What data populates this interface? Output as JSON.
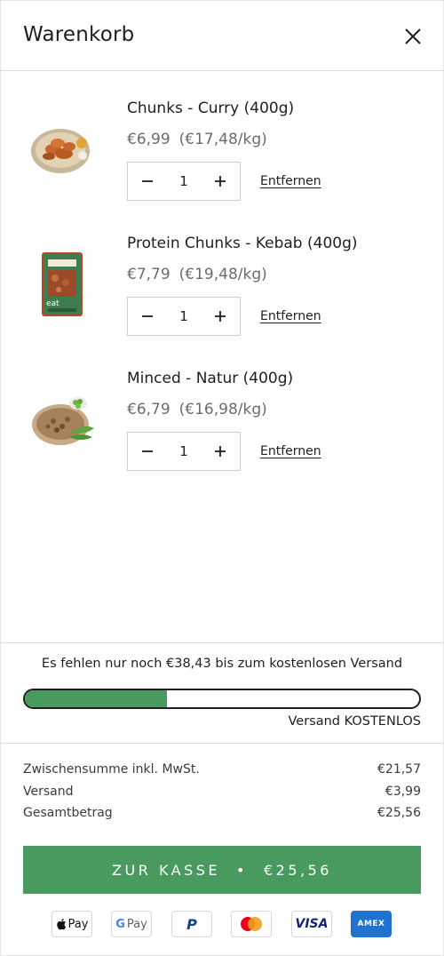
{
  "header": {
    "title": "Warenkorb"
  },
  "items": [
    {
      "name": "Chunks - Curry (400g)",
      "price": "€6,99",
      "unit_price": "(€17,48/kg)",
      "qty": "1",
      "remove": "Entfernen",
      "image": "curry-chunks-bowl-image"
    },
    {
      "name": "Protein Chunks - Kebab (400g)",
      "price": "€7,79",
      "unit_price": "(€19,48/kg)",
      "qty": "1",
      "remove": "Entfernen",
      "image": "kebab-chunks-package-image"
    },
    {
      "name": "Minced - Natur (400g)",
      "price": "€6,79",
      "unit_price": "(€16,98/kg)",
      "qty": "1",
      "remove": "Entfernen",
      "image": "minced-natur-plate-image"
    }
  ],
  "shipping": {
    "message": "Es fehlen nur noch €38,43 bis zum kostenlosen Versand",
    "progress_fraction": 0.36,
    "status": "Versand KOSTENLOS"
  },
  "totals": {
    "subtotal_label": "Zwischensumme inkl. MwSt.",
    "subtotal_value": "€21,57",
    "shipping_label": "Versand",
    "shipping_value": "€3,99",
    "total_label": "Gesamtbetrag",
    "total_value": "€25,56"
  },
  "checkout": {
    "label": "ZUR KASSE",
    "separator": "•",
    "amount": "€25,56"
  },
  "payments": [
    {
      "name": "apple-pay-icon",
      "text": "Pay"
    },
    {
      "name": "google-pay-icon",
      "text": "Pay"
    },
    {
      "name": "paypal-icon",
      "text": "P"
    },
    {
      "name": "mastercard-icon",
      "text": ""
    },
    {
      "name": "visa-icon",
      "text": "VISA"
    },
    {
      "name": "amex-icon",
      "text": "AMEX"
    }
  ],
  "colors": {
    "accent": "#489a5e",
    "text": "#1f1f1f",
    "muted": "#6b6b6b"
  }
}
